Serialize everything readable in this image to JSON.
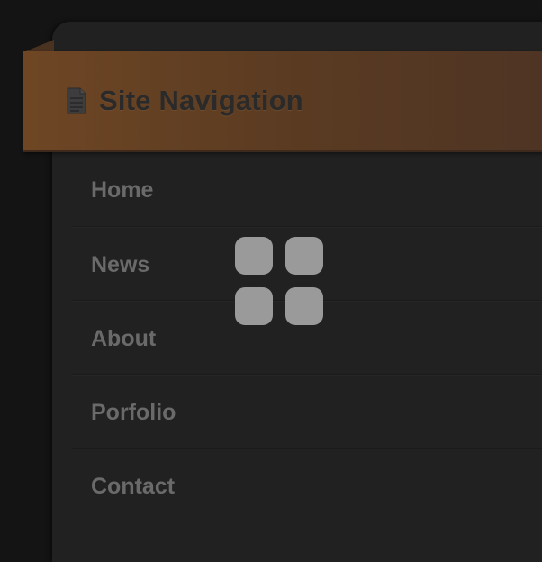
{
  "header": {
    "title": "Site Navigation",
    "icon": "document-icon",
    "ribbon_color": "#5c3c22"
  },
  "nav": {
    "items": [
      {
        "label": "Home"
      },
      {
        "label": "News"
      },
      {
        "label": "About"
      },
      {
        "label": "Porfolio"
      },
      {
        "label": "Contact"
      }
    ]
  },
  "overlay": {
    "icon": "app-grid-icon"
  },
  "colors": {
    "background": "#141414",
    "panel": "#212121",
    "nav_text": "#6a6a6a",
    "title_text": "#2a2a2a",
    "overlay_icon": "#9a9a9a"
  }
}
